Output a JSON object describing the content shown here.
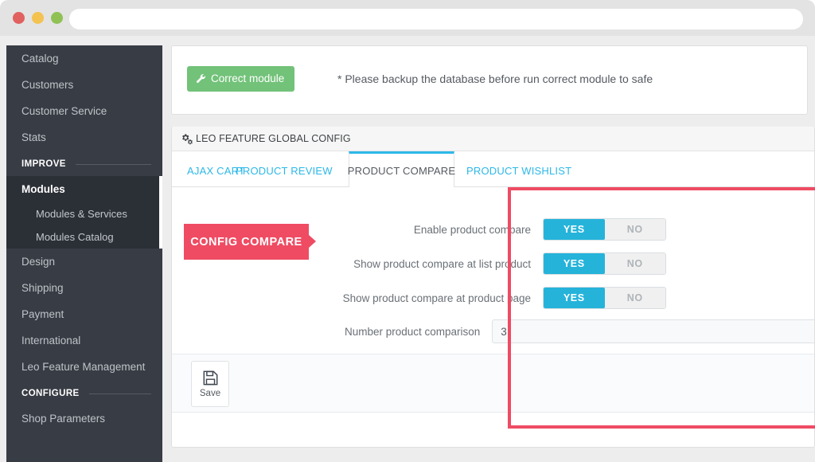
{
  "browser": {
    "url_value": "",
    "url_placeholder": "",
    "traffic_lights": [
      "close-red",
      "minimize-yellow",
      "maximize-green"
    ]
  },
  "sidebar": {
    "items": [
      {
        "label": "Catalog",
        "type": "item"
      },
      {
        "label": "Customers",
        "type": "item"
      },
      {
        "label": "Customer Service",
        "type": "item"
      },
      {
        "label": "Stats",
        "type": "item"
      }
    ],
    "section_improve": "IMPROVE",
    "modules": {
      "label": "Modules",
      "children": [
        {
          "label": "Modules & Services"
        },
        {
          "label": "Modules Catalog"
        }
      ]
    },
    "items_after": [
      {
        "label": "Design"
      },
      {
        "label": "Shipping"
      },
      {
        "label": "Payment"
      },
      {
        "label": "International"
      },
      {
        "label": "Leo Feature Management"
      }
    ],
    "section_configure": "CONFIGURE",
    "items_configure": [
      {
        "label": "Shop Parameters"
      }
    ]
  },
  "notice": {
    "button_label": "Correct module",
    "button_icon": "wrench-icon",
    "button_color": "#72c279",
    "message": "* Please backup the database before run correct module to safe"
  },
  "panel": {
    "header_icon": "cogs-icon",
    "header_title": "LEO FEATURE GLOBAL CONFIG",
    "tabs": [
      {
        "label": "AJAX CART",
        "active": false
      },
      {
        "label": "PRODUCT REVIEW",
        "active": false
      },
      {
        "label": "PRODUCT COMPARE",
        "active": true
      },
      {
        "label": "PRODUCT WISHLIST",
        "active": false
      }
    ],
    "badge_label": "CONFIG COMPARE",
    "badge_color": "#ef4b63",
    "accent_color": "#2cb8e8",
    "rows": [
      {
        "label": "Enable product compare",
        "control": "toggle",
        "yes_label": "YES",
        "no_label": "NO",
        "value": "YES"
      },
      {
        "label": "Show product compare at list product",
        "control": "toggle",
        "yes_label": "YES",
        "no_label": "NO",
        "value": "YES"
      },
      {
        "label": "Show product compare at product page",
        "control": "toggle",
        "yes_label": "YES",
        "no_label": "NO",
        "value": "YES"
      },
      {
        "label": "Number product comparison",
        "control": "text",
        "value": "3",
        "placeholder": ""
      }
    ],
    "save_label": "Save",
    "save_icon": "floppy-disk-icon"
  },
  "annotation": {
    "highlight_color": "#ef4b63"
  }
}
